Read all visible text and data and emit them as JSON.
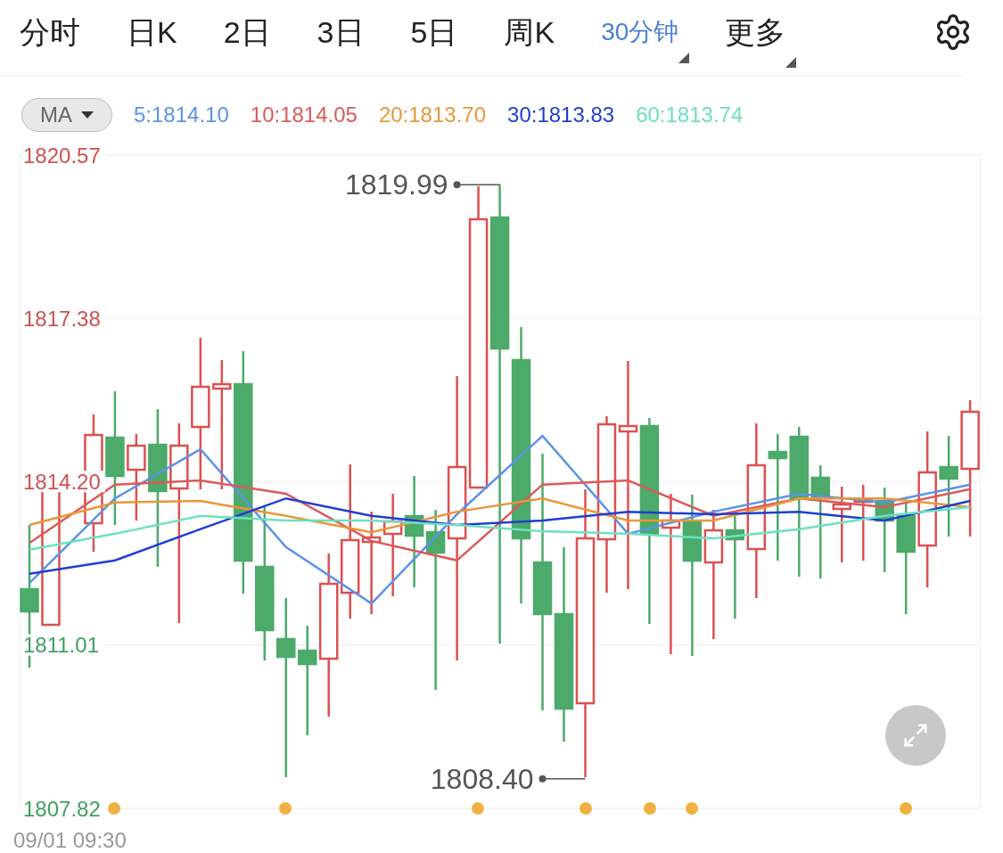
{
  "tabs": [
    {
      "label": "分时",
      "selected": false,
      "dropdown": false
    },
    {
      "label": "日K",
      "selected": false,
      "dropdown": false
    },
    {
      "label": "2日",
      "selected": false,
      "dropdown": false
    },
    {
      "label": "3日",
      "selected": false,
      "dropdown": false
    },
    {
      "label": "5日",
      "selected": false,
      "dropdown": false
    },
    {
      "label": "周K",
      "selected": false,
      "dropdown": false
    },
    {
      "label": "30分钟",
      "selected": true,
      "dropdown": true
    },
    {
      "label": "更多",
      "selected": false,
      "dropdown": true
    }
  ],
  "indicator": {
    "label": "MA",
    "readings": [
      "5:1814.10",
      "10:1814.05",
      "20:1813.70",
      "30:1813.83",
      "60:1813.74"
    ]
  },
  "chart": {
    "chart_data": {
      "type": "line",
      "grid": true,
      "ylim": [
        1807.82,
        1820.57
      ],
      "yticks": [
        {
          "value": 1820.57,
          "label": "1820.57"
        },
        {
          "value": 1817.38,
          "label": "1817.38"
        },
        {
          "value": 1814.2,
          "label": "1814.20"
        },
        {
          "value": 1811.01,
          "label": "1811.01"
        },
        {
          "value": 1807.82,
          "label": "1807.82"
        }
      ],
      "series": [
        {
          "color": "#5b93e6",
          "values": [
            1812.22,
            1813.87,
            1814.83,
            1812.92,
            1811.82,
            1813.56,
            1815.09,
            1813.18,
            1813.61,
            1813.96,
            1813.79,
            1814.14
          ]
        },
        {
          "color": "#dc5a5a",
          "values": [
            1813.0,
            1814.14,
            1814.22,
            1813.96,
            1813.04,
            1812.66,
            1814.14,
            1814.22,
            1813.53,
            1813.87,
            1813.7,
            1814.05
          ]
        },
        {
          "color": "#e8973a",
          "values": [
            1813.35,
            1813.79,
            1813.82,
            1813.53,
            1813.21,
            1813.61,
            1813.87,
            1813.44,
            1813.44,
            1813.87,
            1813.87,
            1813.7
          ]
        },
        {
          "color": "#1f3fcf",
          "values": [
            1812.4,
            1812.66,
            1813.27,
            1813.87,
            1813.53,
            1813.35,
            1813.44,
            1813.61,
            1813.56,
            1813.61,
            1813.44,
            1813.82
          ]
        },
        {
          "color": "#6ee0c0",
          "values": [
            1812.87,
            1813.18,
            1813.53,
            1813.44,
            1813.44,
            1813.35,
            1813.23,
            1813.18,
            1813.09,
            1813.27,
            1813.53,
            1813.7
          ]
        }
      ],
      "annotations": [
        "1819.99",
        "1808.40"
      ]
    },
    "time_label": "09/01 09:30"
  }
}
